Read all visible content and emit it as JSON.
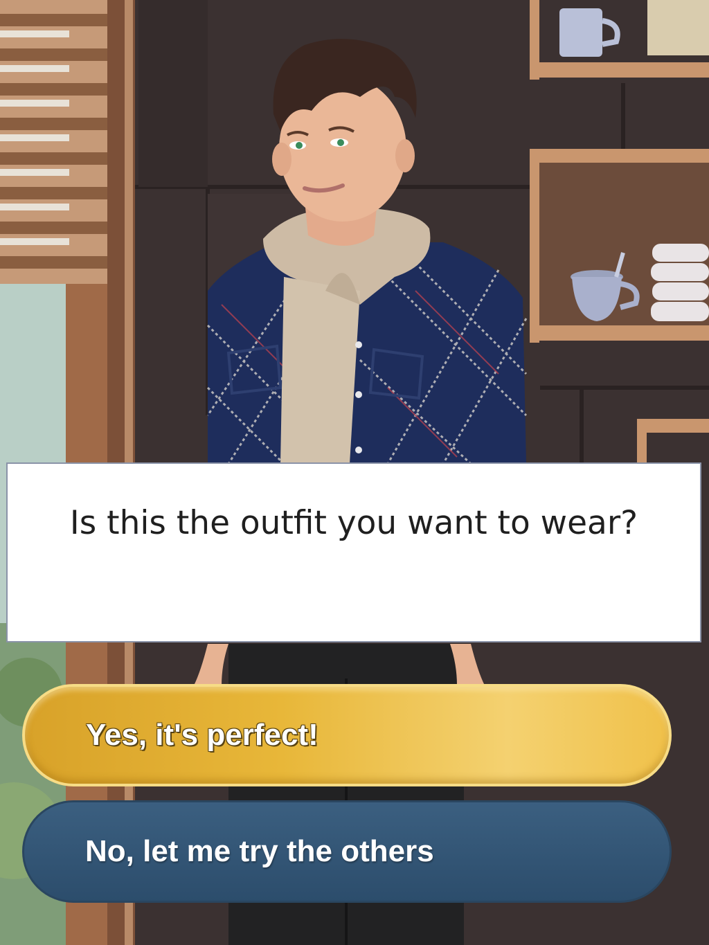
{
  "dialog": {
    "text": "Is this the outfit you want to wear?"
  },
  "choices": [
    {
      "label": "Yes, it's perfect!"
    },
    {
      "label": "No, let me try the others"
    }
  ],
  "colors": {
    "choice_primary": "#e8b739",
    "choice_secondary": "#2f5070",
    "dialog_background": "#ffffff"
  }
}
